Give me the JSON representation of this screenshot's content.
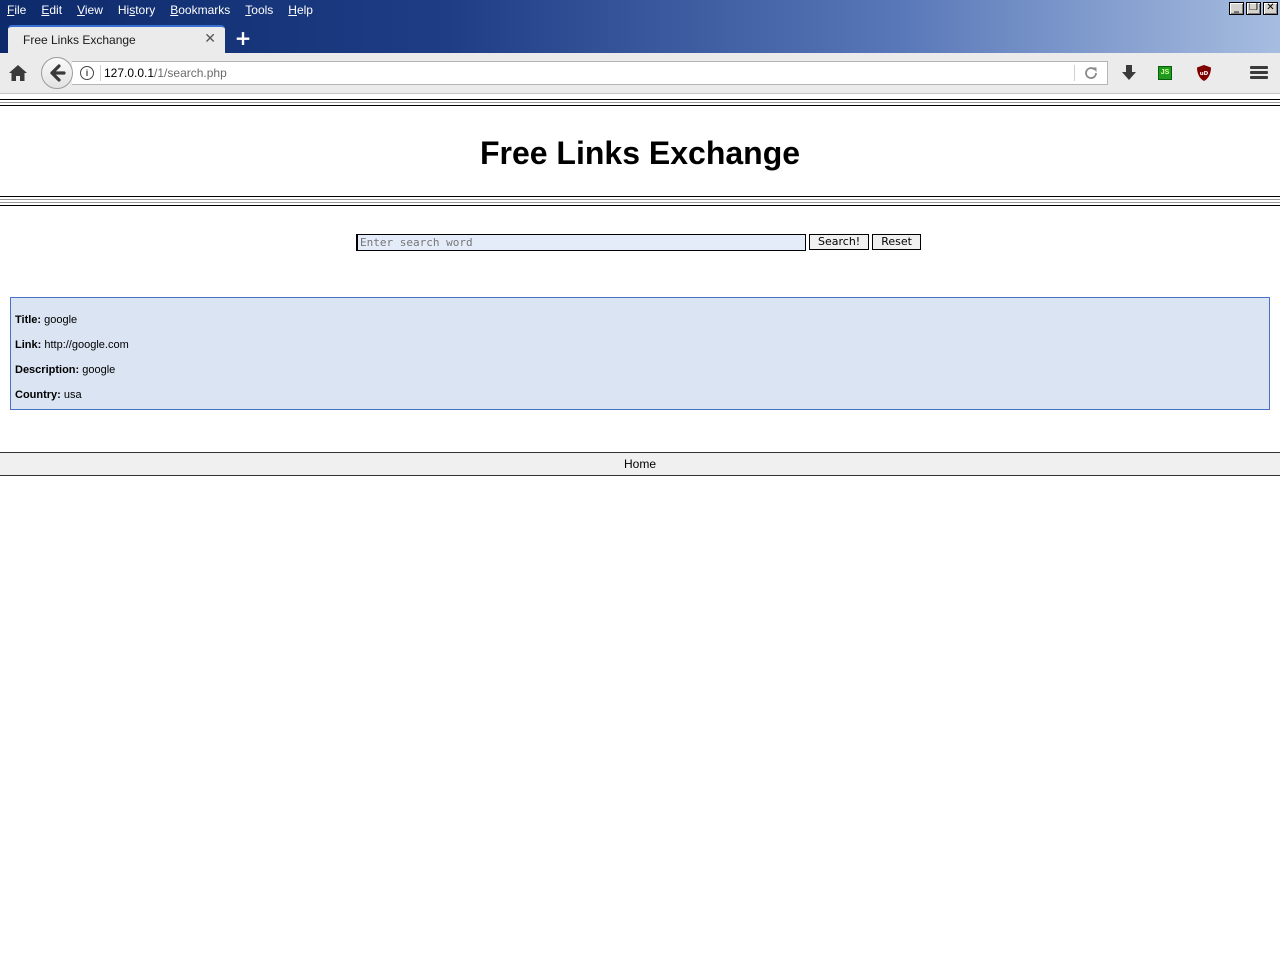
{
  "browser": {
    "menu": [
      "File",
      "Edit",
      "View",
      "History",
      "Bookmarks",
      "Tools",
      "Help"
    ],
    "menu_accel": [
      "F",
      "E",
      "V",
      "H",
      "B",
      "T",
      "H"
    ],
    "tab_title": "Free Links Exchange",
    "url_host": "127.0.0.1",
    "url_path": "/1/search.php",
    "js_badge": "JS",
    "ublock_badge": "uD"
  },
  "page": {
    "title": "Free Links Exchange",
    "search": {
      "placeholder": "Enter search word",
      "value": "",
      "search_label": "Search!",
      "reset_label": "Reset"
    },
    "result": {
      "title_label": "Title:",
      "title_value": "google",
      "link_label": "Link:",
      "link_value": "http://google.com",
      "description_label": "Description:",
      "description_value": "google",
      "country_label": "Country:",
      "country_value": "usa"
    },
    "footer": {
      "home_label": "Home"
    }
  },
  "colors": {
    "result_bg": "#dbe4f3",
    "result_border": "#4a72c2",
    "input_bg": "#e5ecf9"
  }
}
